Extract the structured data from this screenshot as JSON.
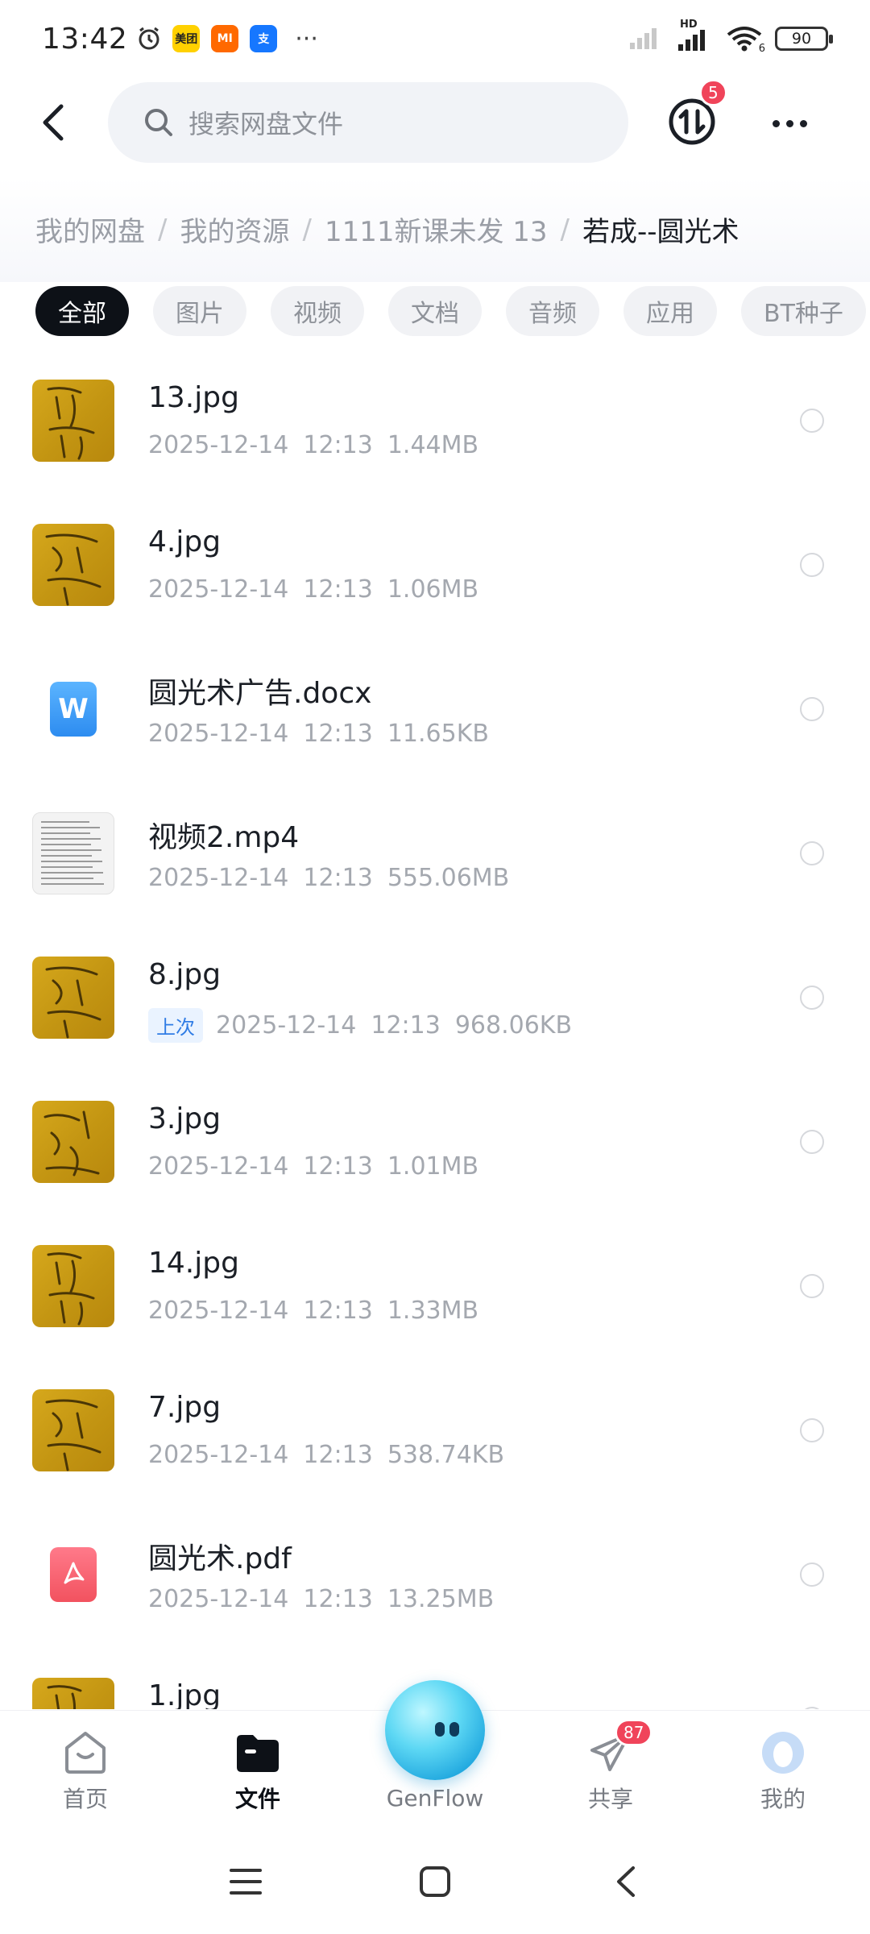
{
  "status_bar": {
    "time": "13:42",
    "apps": [
      {
        "name": "meituan-icon",
        "text": "美团",
        "color": "#ffd100",
        "fg": "#222"
      },
      {
        "name": "mi-icon",
        "text": "MI",
        "color": "#ff6900",
        "fg": "#fff"
      },
      {
        "name": "alipay-icon",
        "text": "支",
        "color": "#1677ff",
        "fg": "#fff"
      }
    ],
    "more": "···",
    "network_label": "HD",
    "wifi_label": "6",
    "battery": "90"
  },
  "header": {
    "search_placeholder": "搜索网盘文件",
    "transfer_badge": "5"
  },
  "breadcrumb": [
    "我的网盘",
    "我的资源",
    "1111新课未发 13",
    "若成--圆光术"
  ],
  "filters": [
    {
      "label": "全部",
      "active": true
    },
    {
      "label": "图片",
      "active": false
    },
    {
      "label": "视频",
      "active": false
    },
    {
      "label": "文档",
      "active": false
    },
    {
      "label": "音频",
      "active": false
    },
    {
      "label": "应用",
      "active": false
    },
    {
      "label": "BT种子",
      "active": false
    }
  ],
  "files": [
    {
      "name": "13.jpg",
      "date": "2025-12-14",
      "time": "12:13",
      "size": "1.44MB",
      "kind": "image",
      "tag": ""
    },
    {
      "name": "4.jpg",
      "date": "2025-12-14",
      "time": "12:13",
      "size": "1.06MB",
      "kind": "image",
      "tag": ""
    },
    {
      "name": "圆光术广告.docx",
      "date": "2025-12-14",
      "time": "12:13",
      "size": "11.65KB",
      "kind": "doc",
      "tag": ""
    },
    {
      "name": "视频2.mp4",
      "date": "2025-12-14",
      "time": "12:13",
      "size": "555.06MB",
      "kind": "video",
      "tag": ""
    },
    {
      "name": "8.jpg",
      "date": "2025-12-14",
      "time": "12:13",
      "size": "968.06KB",
      "kind": "image",
      "tag": "上次"
    },
    {
      "name": "3.jpg",
      "date": "2025-12-14",
      "time": "12:13",
      "size": "1.01MB",
      "kind": "image",
      "tag": ""
    },
    {
      "name": "14.jpg",
      "date": "2025-12-14",
      "time": "12:13",
      "size": "1.33MB",
      "kind": "image",
      "tag": ""
    },
    {
      "name": "7.jpg",
      "date": "2025-12-14",
      "time": "12:13",
      "size": "538.74KB",
      "kind": "image",
      "tag": ""
    },
    {
      "name": "圆光术.pdf",
      "date": "2025-12-14",
      "time": "12:13",
      "size": "13.25MB",
      "kind": "pdf",
      "tag": ""
    },
    {
      "name": "1.jpg",
      "date": "",
      "time": "",
      "size": "",
      "kind": "image",
      "tag": ""
    }
  ],
  "bottom_nav": {
    "items": [
      {
        "label": "首页",
        "icon": "home-icon",
        "active": false
      },
      {
        "label": "文件",
        "icon": "folder-icon",
        "active": true
      },
      {
        "label": "GenFlow",
        "icon": "genflow-orb-icon",
        "active": false
      },
      {
        "label": "共享",
        "icon": "share-plane-icon",
        "active": false,
        "badge": "87"
      },
      {
        "label": "我的",
        "icon": "profile-icon",
        "active": false
      }
    ]
  },
  "system_nav": [
    "menu-icon",
    "home-square-icon",
    "back-arrow-icon"
  ]
}
